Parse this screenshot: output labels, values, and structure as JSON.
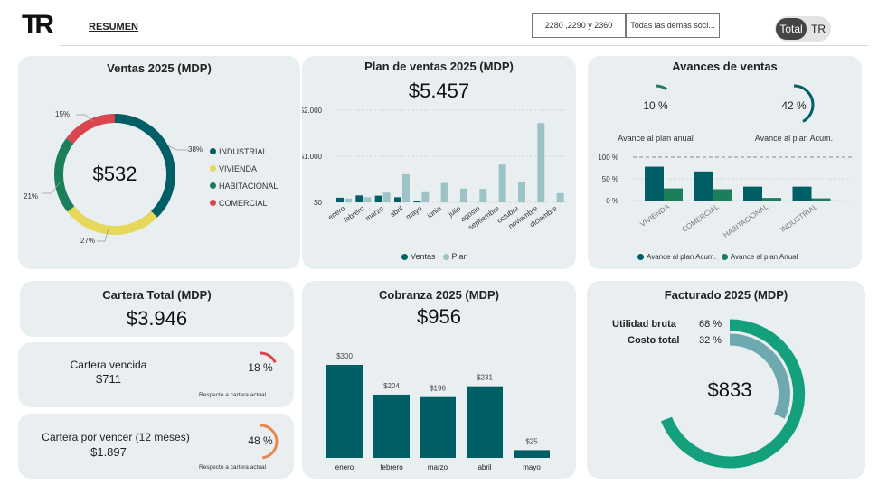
{
  "header": {
    "logo_text": "TR",
    "nav_label": "RESUMEN",
    "slicer1_value": "2280 ,2290 y 2360",
    "slicer2_value": "Todas las demas soci...",
    "toggle_total": "Total",
    "toggle_tr": "TR"
  },
  "ventas": {
    "title": "Ventas 2025 (MDP)",
    "total": "$532",
    "legend": [
      {
        "label": "INDUSTRIAL",
        "color": "#005e66"
      },
      {
        "label": "VIVIENDA",
        "color": "#e6d85a"
      },
      {
        "label": "HABITACIONAL",
        "color": "#1a7f5a"
      },
      {
        "label": "COMERCIAL",
        "color": "#d9464f"
      }
    ],
    "pct_labels": [
      "38%",
      "27%",
      "21%",
      "15%"
    ]
  },
  "plan": {
    "title": "Plan de ventas 2025 (MDP)",
    "total": "$5.457",
    "legend_ventas": "Ventas",
    "legend_plan": "Plan"
  },
  "avances": {
    "title": "Avances de ventas",
    "gauge1_value": "10 %",
    "gauge1_label": "Avance al plan anual",
    "gauge2_value": "42 %",
    "gauge2_label": "Avance al plan Acum.",
    "legend_acum": "Avance al plan Acum.",
    "legend_anual": "Avance al plan Anual"
  },
  "cartera": {
    "title": "Cartera Total (MDP)",
    "total": "$3.946",
    "vencida_label": "Cartera vencida",
    "vencida_value": "$711",
    "vencida_pct": "18 %",
    "vencida_note": "Respecto a cartera actual",
    "vencer_label": "Cartera por vencer (12 meses)",
    "vencer_value": "$1.897",
    "vencer_pct": "48 %",
    "vencer_note": "Respecto a cartera actual"
  },
  "cobranza": {
    "title": "Cobranza 2025 (MDP)",
    "total": "$956"
  },
  "facturado": {
    "title": "Facturado 2025 (MDP)",
    "total": "$833",
    "utilidad_label": "Utilidad bruta",
    "utilidad_value": "68 %",
    "costo_label": "Costo total",
    "costo_value": "32 %"
  },
  "chart_data": [
    {
      "type": "pie",
      "title": "Ventas 2025 (MDP)",
      "categories": [
        "INDUSTRIAL",
        "VIVIENDA",
        "HABITACIONAL",
        "COMERCIAL"
      ],
      "values": [
        38,
        27,
        21,
        15
      ],
      "colors": [
        "#005e66",
        "#e6d85a",
        "#1a7f5a",
        "#d9464f"
      ]
    },
    {
      "type": "bar",
      "title": "Plan de ventas 2025 (MDP)",
      "categories": [
        "enero",
        "febrero",
        "marzo",
        "abril",
        "mayo",
        "junio",
        "julio",
        "agosto",
        "septiembre",
        "octubre",
        "noviembre",
        "diciembre"
      ],
      "series": [
        {
          "name": "Ventas",
          "values": [
            100,
            150,
            145,
            110,
            25,
            0,
            0,
            0,
            0,
            0,
            0,
            0
          ],
          "color": "#005e66"
        },
        {
          "name": "Plan",
          "values": [
            80,
            110,
            210,
            610,
            220,
            420,
            300,
            290,
            820,
            440,
            1720,
            200
          ],
          "color": "#9cc3c6"
        }
      ],
      "yticks": [
        "$0",
        "$1.000",
        "$2.000"
      ],
      "ylim": [
        0,
        2000
      ]
    },
    {
      "type": "bar",
      "title": "Avances de ventas",
      "categories": [
        "VIVIENDA",
        "COMERCIAL",
        "HABITACIONAL",
        "INDUSTRIAL"
      ],
      "series": [
        {
          "name": "Avance al plan Acum.",
          "values": [
            78,
            67,
            32,
            32
          ],
          "color": "#005e66"
        },
        {
          "name": "Avance al plan Anual",
          "values": [
            28,
            26,
            6,
            5
          ],
          "color": "#1a7f5a"
        }
      ],
      "yticks": [
        "0 %",
        "50 %",
        "100 %"
      ],
      "ylim": [
        0,
        100
      ]
    },
    {
      "type": "bar",
      "title": "Cobranza 2025 (MDP)",
      "categories": [
        "enero",
        "febrero",
        "marzo",
        "abril",
        "mayo"
      ],
      "values": [
        300,
        204,
        196,
        231,
        25
      ],
      "value_labels": [
        "$300",
        "$204",
        "$196",
        "$231",
        "$25"
      ],
      "color": "#005e66"
    }
  ]
}
